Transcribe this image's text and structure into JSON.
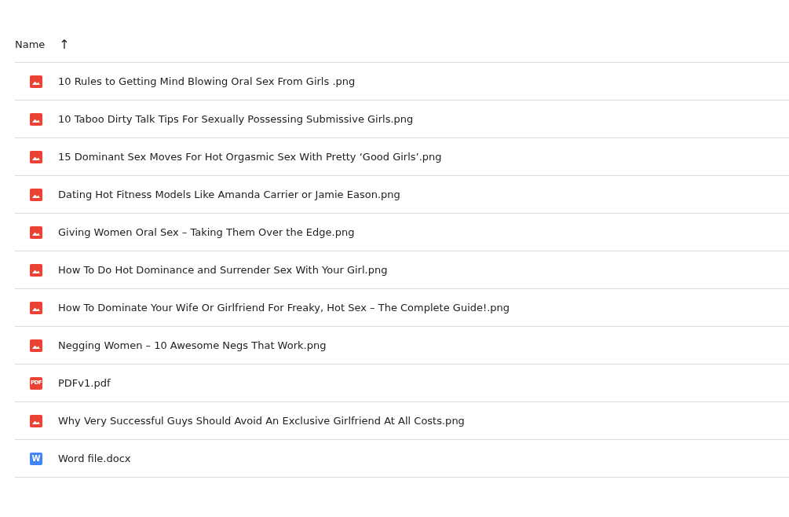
{
  "header": {
    "column": "Name",
    "sort_icon": "↑"
  },
  "files": [
    {
      "name": "10 Rules to Getting Mind Blowing Oral Sex From Girls .png",
      "kind": "image"
    },
    {
      "name": "10 Taboo Dirty Talk Tips For Sexually Possessing Submissive Girls.png",
      "kind": "image"
    },
    {
      "name": "15 Dominant Sex Moves For Hot Orgasmic Sex With Pretty ‘Good Girls’.png",
      "kind": "image"
    },
    {
      "name": "Dating Hot Fitness Models Like Amanda Carrier or Jamie Eason.png",
      "kind": "image"
    },
    {
      "name": "Giving Women Oral Sex – Taking Them Over the Edge.png",
      "kind": "image"
    },
    {
      "name": "How To Do Hot Dominance and Surrender Sex With Your Girl.png",
      "kind": "image"
    },
    {
      "name": "How To Dominate Your Wife Or Girlfriend For Freaky, Hot Sex – The Complete Guide!.png",
      "kind": "image"
    },
    {
      "name": "Negging Women – 10 Awesome Negs That Work.png",
      "kind": "image"
    },
    {
      "name": "PDFv1.pdf",
      "kind": "pdf",
      "icon_text": "PDF"
    },
    {
      "name": "Why Very Successful Guys Should Avoid An Exclusive Girlfriend At All Costs.png",
      "kind": "image"
    },
    {
      "name": "Word file.docx",
      "kind": "word",
      "icon_text": "W"
    }
  ]
}
